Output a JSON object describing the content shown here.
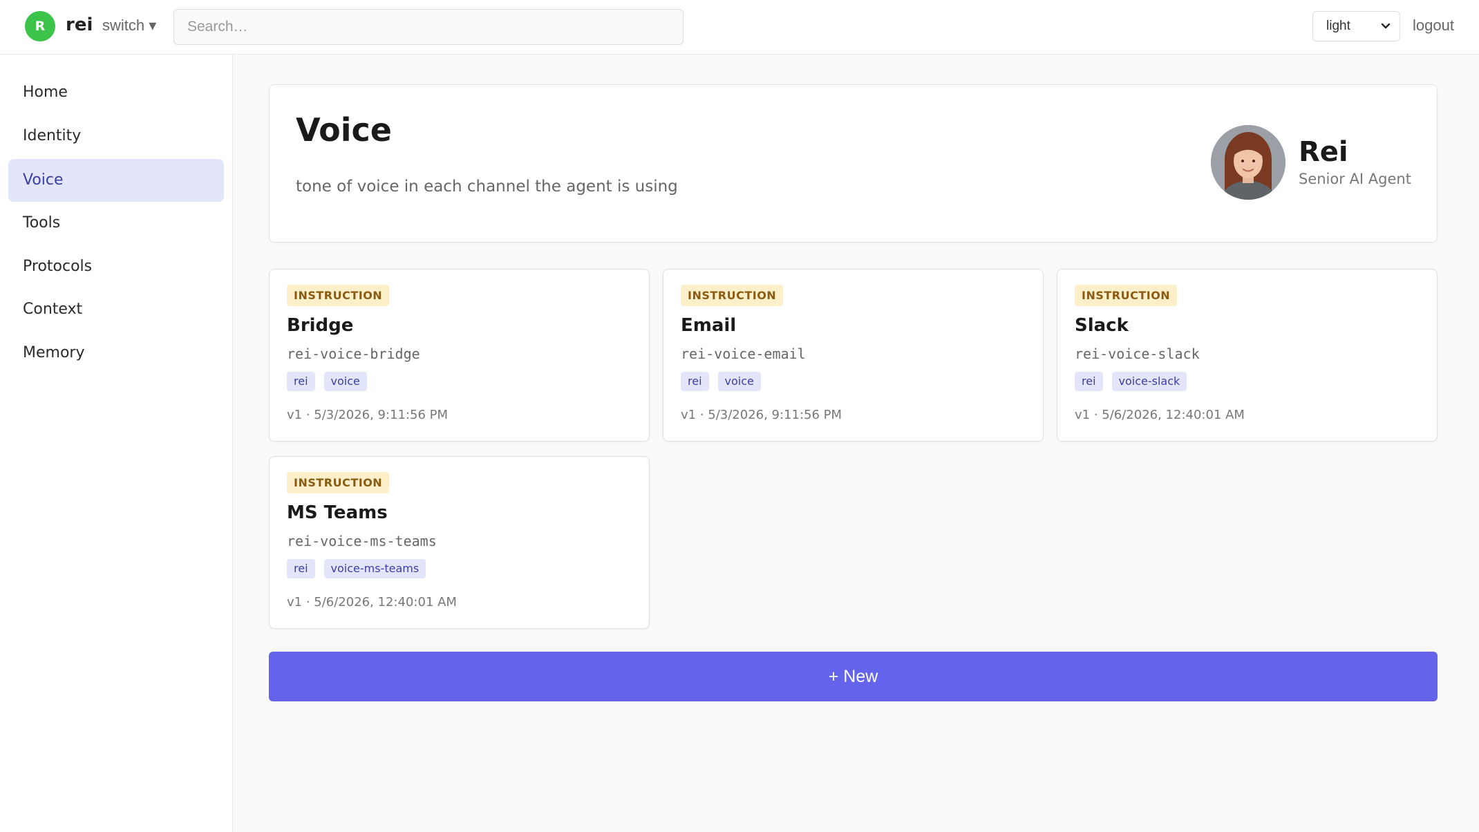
{
  "topbar": {
    "avatar_letter": "R",
    "workspace_name": "rei",
    "switch_label": "switch ▾",
    "search_placeholder": "Search…",
    "theme_value": "light",
    "logout_label": "logout"
  },
  "sidebar": {
    "items": [
      {
        "label": "Home",
        "active": false
      },
      {
        "label": "Identity",
        "active": false
      },
      {
        "label": "Voice",
        "active": true
      },
      {
        "label": "Tools",
        "active": false
      },
      {
        "label": "Protocols",
        "active": false
      },
      {
        "label": "Context",
        "active": false
      },
      {
        "label": "Memory",
        "active": false
      }
    ]
  },
  "header": {
    "title": "Voice",
    "subtitle": "tone of voice in each channel the agent is using",
    "agent_name": "Rei",
    "agent_role": "Senior AI Agent"
  },
  "cards": [
    {
      "badge": "INSTRUCTION",
      "title": "Bridge",
      "slug": "rei-voice-bridge",
      "tags": [
        "rei",
        "voice"
      ],
      "meta": "v1 · 5/3/2026, 9:11:56 PM"
    },
    {
      "badge": "INSTRUCTION",
      "title": "Email",
      "slug": "rei-voice-email",
      "tags": [
        "rei",
        "voice"
      ],
      "meta": "v1 · 5/3/2026, 9:11:56 PM"
    },
    {
      "badge": "INSTRUCTION",
      "title": "Slack",
      "slug": "rei-voice-slack",
      "tags": [
        "rei",
        "voice-slack"
      ],
      "meta": "v1 · 5/6/2026, 12:40:01 AM"
    },
    {
      "badge": "INSTRUCTION",
      "title": "MS Teams",
      "slug": "rei-voice-ms-teams",
      "tags": [
        "rei",
        "voice-ms-teams"
      ],
      "meta": "v1 · 5/6/2026, 12:40:01 AM"
    }
  ],
  "new_button_label": "+ New",
  "colors": {
    "accent": "#6363ec",
    "active_nav_bg": "#e3e5fb",
    "badge_bg": "#fcefc9",
    "avatar_green": "#3cc44a"
  }
}
